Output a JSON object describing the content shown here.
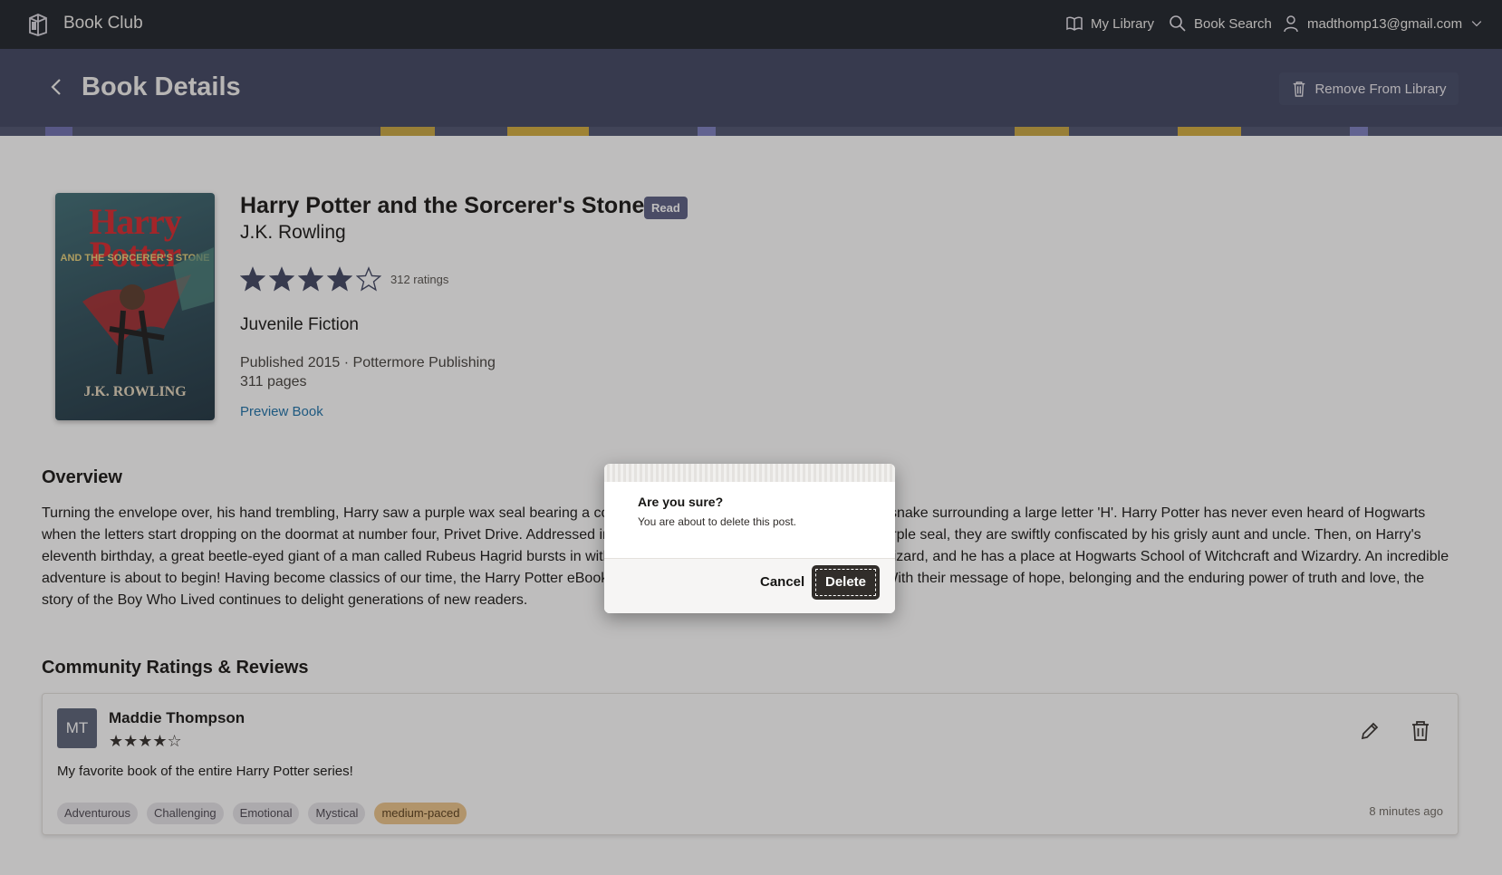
{
  "topbar": {
    "app_title": "Book Club",
    "nav": [
      {
        "label": "My Library",
        "icon": "book-open-icon"
      },
      {
        "label": "Book Search",
        "icon": "search-icon"
      },
      {
        "label": "madthomp13@gmail.com",
        "icon": "user-icon"
      }
    ]
  },
  "header": {
    "title": "Book Details",
    "remove_label": "Remove From Library"
  },
  "book": {
    "cover_title": "Harry Potter",
    "cover_subtitle": "AND THE SORCERER'S STONE",
    "cover_author": "J.K. ROWLING",
    "title": "Harry Potter and the Sorcerer's Stone",
    "status_badge": "Read",
    "author": "J.K. Rowling",
    "rating_stars": 4,
    "rating_max": 5,
    "ratings_count": "312 ratings",
    "genre": "Juvenile Fiction",
    "published": "Published 2015 · Pottermore Publishing",
    "pages": "311 pages",
    "preview_label": "Preview Book"
  },
  "overview": {
    "heading": "Overview",
    "text": "Turning the envelope over, his hand trembling, Harry saw a purple wax seal bearing a coat of arms; a lion, an eagle, a badger and a snake surrounding a large letter 'H'. Harry Potter has never even heard of Hogwarts when the letters start dropping on the doormat at number four, Privet Drive. Addressed in green ink on yellowish parchment with a purple seal, they are swiftly confiscated by his grisly aunt and uncle. Then, on Harry's eleventh birthday, a great beetle-eyed giant of a man called Rubeus Hagrid bursts in with some astonishing news: Harry Potter is a wizard, and he has a place at Hogwarts School of Witchcraft and Wizardry. An incredible adventure is about to begin! Having become classics of our time, the Harry Potter eBooks never fail to bring comfort and escapism. With their message of hope, belonging and the enduring power of truth and love, the story of the Boy Who Lived continues to delight generations of new readers."
  },
  "reviews": {
    "heading": "Community Ratings & Reviews",
    "items": [
      {
        "initials": "MT",
        "name": "Maddie Thompson",
        "stars": "★★★★☆",
        "text": "My favorite book of the entire Harry Potter series!",
        "tags": [
          "Adventurous",
          "Challenging",
          "Emotional",
          "Mystical"
        ],
        "pace_tag": "medium-paced",
        "time": "8 minutes ago"
      }
    ]
  },
  "dialog": {
    "title": "Are you sure?",
    "message": "You are about to delete this post.",
    "cancel_label": "Cancel",
    "delete_label": "Delete"
  },
  "colors": {
    "topbar": "#1c2129",
    "header": "#3e4460",
    "badge": "#5a5e83",
    "link": "#1b70a8",
    "delete_button": "#312d2a",
    "pace_tag": "#ecc48a"
  }
}
